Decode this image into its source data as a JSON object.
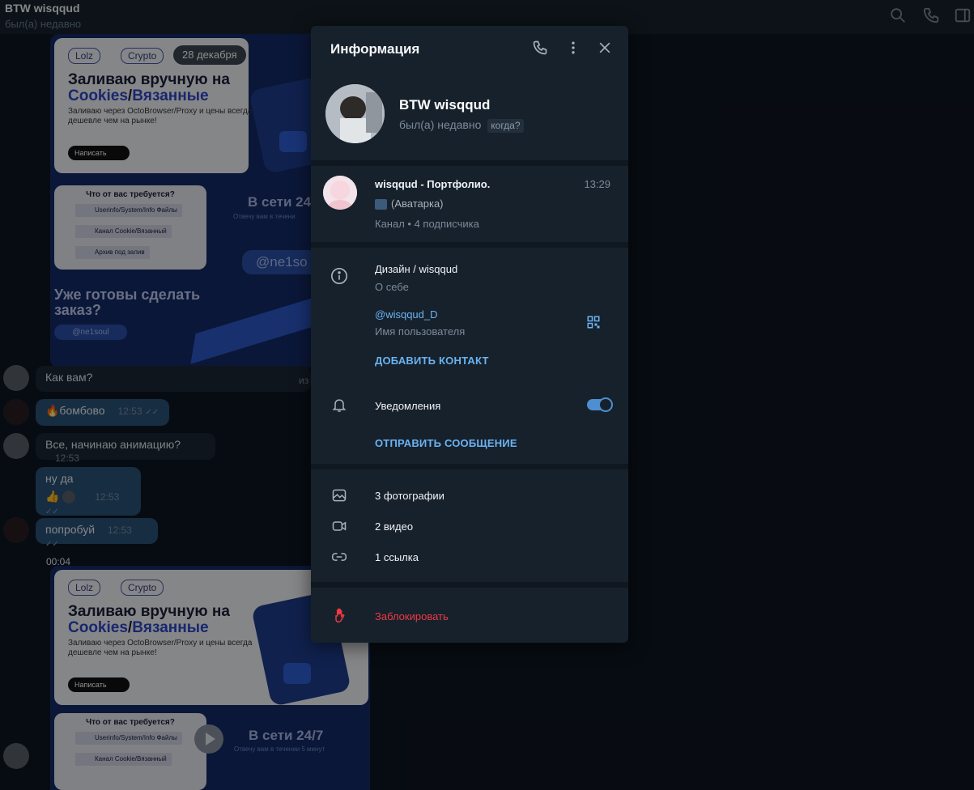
{
  "header": {
    "title": "BTW wisqqud",
    "status": "был(а) недавно"
  },
  "icons": {
    "search": "search-icon",
    "call": "phone-icon",
    "sidebar": "sidebar-toggle-icon"
  },
  "chat": {
    "date_chip": "28 декабря",
    "promo1": {
      "pills": [
        "Lolz",
        "Crypto"
      ],
      "title_line1": "Заливаю вручную на",
      "title_line2_a": "Cookies",
      "title_line2_sep": "/",
      "title_line2_b": "Вязанные",
      "subtitle": "Заливаю через OctoBrowser/Proxy и цены всегда дешевле чем на рынке!",
      "write_button": "Написать",
      "req_title": "Что от вас требуется?",
      "req_items": [
        "Userinfo/System/Info Файлы",
        "Канал Cookie/Вязанный",
        "Архив под залив"
      ],
      "online": "В сети 24",
      "online_sub": "Отвечу вам в течени",
      "handle": "@ne1so",
      "cta_line1": "Уже готовы сделать",
      "cta_line2": "заказ?",
      "cta_handle": "@ne1soul"
    },
    "messages": [
      {
        "side": "in",
        "text": "Как вам?",
        "time": "",
        "trailing": "из"
      },
      {
        "side": "out",
        "text": "🔥бомбово",
        "time": "12:53",
        "read": true
      },
      {
        "side": "in",
        "text": "Все, начинаю анимацию?",
        "time": "12:53"
      },
      {
        "side": "out",
        "text": "ну да",
        "reactions": "👍",
        "time": "12:53",
        "read": true
      },
      {
        "side": "out",
        "text": "попробуй",
        "time": "12:53",
        "read": true
      }
    ],
    "video_timer": "00:04",
    "promo2": {
      "pills": [
        "Lolz",
        "Crypto"
      ],
      "title_line1": "Заливаю вручную на",
      "title_line2_a": "Cookies",
      "title_line2_sep": "/",
      "title_line2_b": "Вязанные",
      "subtitle": "Заливаю через OctoBrowser/Proxy и цены всегда дешевле чем на рынке!",
      "write_button": "Написать",
      "req_title": "Что от вас требуется?",
      "req_items": [
        "Userinfo/System/Info Файлы",
        "Канал Cookie/Вязанный"
      ],
      "online": "В сети 24/7",
      "online_sub": "Отвечу вам в течении 5 минут"
    }
  },
  "panel": {
    "title": "Информация",
    "name": "BTW wisqqud",
    "status": "был(а) недавно",
    "when": "когда?",
    "channel": {
      "name": "wisqqud - Портфолио.",
      "time": "13:29",
      "last_message": "(Аватарка)",
      "subscribers": "Канал • 4 подписчика"
    },
    "bio": "Дизайн / wisqqud",
    "bio_label": "О себе",
    "username": "@wisqqud_D",
    "username_label": "Имя пользователя",
    "add_contact": "ДОБАВИТЬ КОНТАКТ",
    "notifications": "Уведомления",
    "notifications_on": true,
    "send_message": "ОТПРАВИТЬ СООБЩЕНИЕ",
    "media": {
      "photos": "3 фотографии",
      "videos": "2 видео",
      "links": "1 ссылка"
    },
    "block": "Заблокировать",
    "colors": {
      "accent": "#6ab3f3",
      "danger": "#ec3942",
      "panel_bg": "#17212b",
      "toggle": "#4d8fd0"
    }
  }
}
